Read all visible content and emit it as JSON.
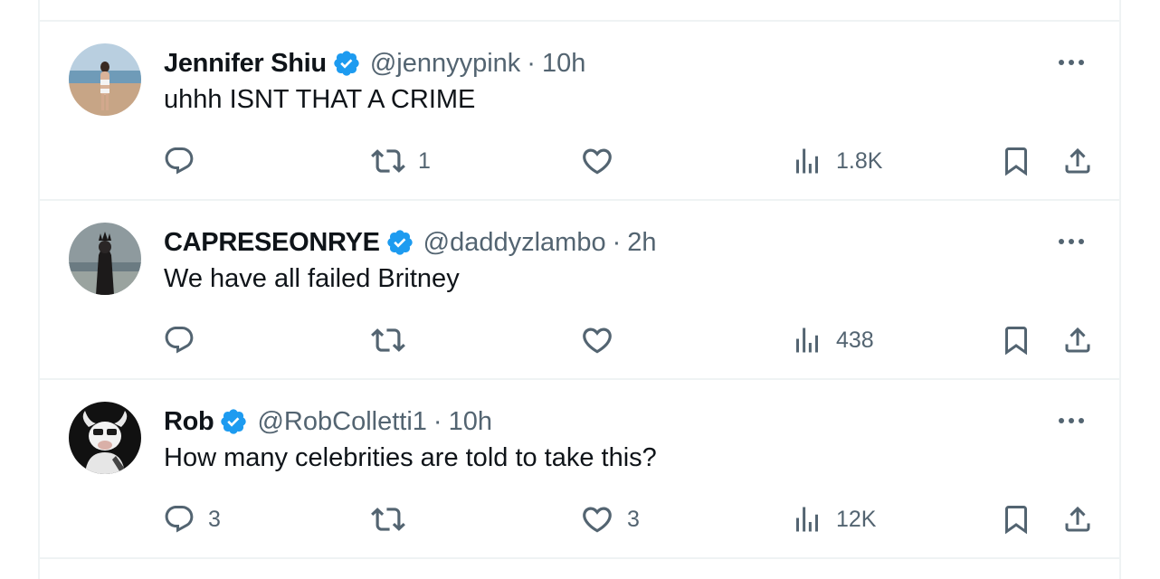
{
  "tweets": [
    {
      "name": "Jennifer Shiu",
      "handle": "@jennyypink",
      "separator": "·",
      "time": "10h",
      "text": "uhhh ISNT THAT A CRIME",
      "avatar": "beach-photo",
      "replies": "",
      "retweets": "1",
      "likes": "",
      "views": "1.8K"
    },
    {
      "name": "CAPRESEONRYE",
      "handle": "@daddyzlambo",
      "separator": "·",
      "time": "2h",
      "text": "We have all failed Britney",
      "avatar": "dark-figure-photo",
      "replies": "",
      "retweets": "",
      "likes": "",
      "views": "438"
    },
    {
      "name": "Rob",
      "handle": "@RobColletti1",
      "separator": "·",
      "time": "10h",
      "text": "How many celebrities are told to take this?",
      "avatar": "cartoon-bull",
      "replies": "3",
      "retweets": "",
      "likes": "3",
      "views": "12K"
    }
  ],
  "colors": {
    "verified": "#1d9bf0",
    "icon_gray": "#536471",
    "divider": "#eff3f4"
  }
}
